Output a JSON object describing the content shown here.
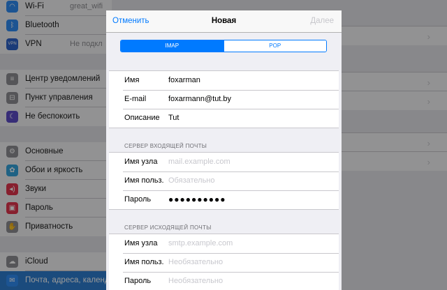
{
  "settings_sidebar": {
    "items": [
      {
        "label": "Wi-Fi",
        "value": "great_wifi",
        "icon": "wifi-icon",
        "color": "#2f8cf3"
      },
      {
        "label": "Bluetooth",
        "value": "",
        "icon": "bluetooth-icon",
        "color": "#2f8cf3"
      },
      {
        "label": "VPN",
        "value": "Не подкл",
        "icon": "vpn-icon",
        "color": "#2d63c8"
      },
      {
        "label": "Центр уведомлений",
        "value": "",
        "icon": "notifications-icon",
        "color": "#8e8e93"
      },
      {
        "label": "Пункт управления",
        "value": "",
        "icon": "control-center-icon",
        "color": "#8e8e93"
      },
      {
        "label": "Не беспокоить",
        "value": "",
        "icon": "do-not-disturb-icon",
        "color": "#5d4cc7"
      },
      {
        "label": "Основные",
        "value": "",
        "icon": "general-icon",
        "color": "#8e8e93"
      },
      {
        "label": "Обои и яркость",
        "value": "",
        "icon": "wallpaper-icon",
        "color": "#35a3dc"
      },
      {
        "label": "Звуки",
        "value": "",
        "icon": "sounds-icon",
        "color": "#e2354d"
      },
      {
        "label": "Пароль",
        "value": "",
        "icon": "passcode-icon",
        "color": "#e2354d"
      },
      {
        "label": "Приватность",
        "value": "",
        "icon": "privacy-icon",
        "color": "#8e8e93"
      },
      {
        "label": "iCloud",
        "value": "",
        "icon": "icloud-icon",
        "color": "#8e8e93"
      },
      {
        "label": "Почта, адреса, календари",
        "value": "",
        "icon": "mail-icon",
        "color": "#2f8cf3",
        "selected": true
      }
    ]
  },
  "sheet": {
    "cancel_label": "Отменить",
    "title": "Новая",
    "next_label": "Далее",
    "segments": [
      {
        "label": "IMAP",
        "selected": true
      },
      {
        "label": "POP",
        "selected": false
      }
    ],
    "account": {
      "name_label": "Имя",
      "name_value": "foxarman",
      "email_label": "E-mail",
      "email_value": "foxarmann@tut.by",
      "desc_label": "Описание",
      "desc_value": "Tut"
    },
    "incoming": {
      "header": "СЕРВЕР ВХОДЯЩЕЙ ПОЧТЫ",
      "host_label": "Имя узла",
      "host_placeholder": "mail.example.com",
      "user_label": "Имя польз.",
      "user_placeholder": "Обязательно",
      "pass_label": "Пароль",
      "pass_value": "●●●●●●●●●●"
    },
    "outgoing": {
      "header": "СЕРВЕР ИСХОДЯЩЕЙ ПОЧТЫ",
      "host_label": "Имя узла",
      "host_placeholder": "smtp.example.com",
      "user_label": "Имя польз.",
      "user_placeholder": "Необязательно",
      "pass_label": "Пароль",
      "pass_placeholder": "Необязательно"
    }
  },
  "colors": {
    "accent": "#007aff",
    "selected_row": "#2d7ed1"
  }
}
